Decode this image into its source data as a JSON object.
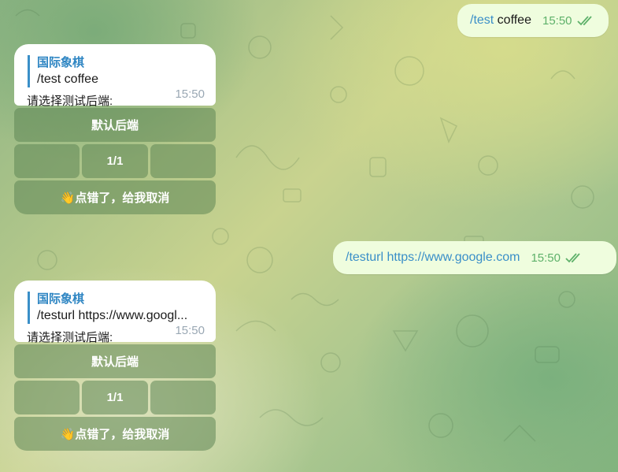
{
  "outgoing": [
    {
      "command": "/test",
      "text": " coffee",
      "time": "15:50"
    },
    {
      "command": "/testurl https://www.google.com",
      "text": "",
      "time": "15:50"
    }
  ],
  "incoming": [
    {
      "quote_name": "国际象棋",
      "quote_text": "/test coffee",
      "body": "请选择测试后端:",
      "time": "15:50",
      "buttons": {
        "default": "默认后端",
        "page": "1/1",
        "cancel": "👋点错了，给我取消"
      }
    },
    {
      "quote_name": "国际象棋",
      "quote_text": "/testurl https://www.googl...",
      "body": "请选择测试后端:",
      "time": "15:50",
      "buttons": {
        "default": "默认后端",
        "page": "1/1",
        "cancel": "👋点错了，给我取消"
      }
    }
  ],
  "colors": {
    "outgoing_bubble": "#effdde",
    "link": "#3a8fc8",
    "read_ticks": "#5eb16a"
  },
  "icons": [
    "double-check-icon",
    "waving-hand-icon"
  ]
}
